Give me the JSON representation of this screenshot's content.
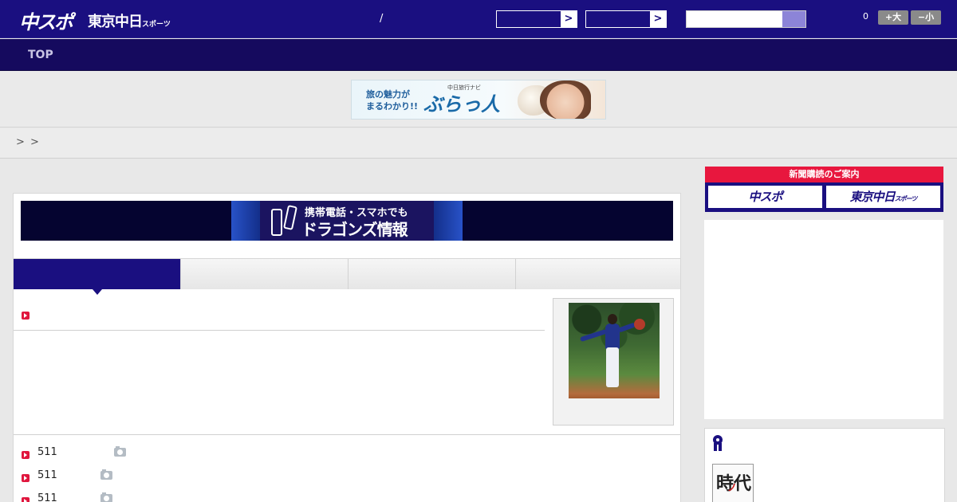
{
  "header": {
    "logo_main": "中スポ",
    "logo_tokyo": "東京中日",
    "logo_tokyo_suffix": "スポーツ",
    "slash": "/",
    "select_arrow": ">",
    "notification_count": "0",
    "font_larger": "+大",
    "font_smaller": "−小"
  },
  "nav": {
    "top_label": "TOP"
  },
  "ad_banner": {
    "line1": "旅の魅力が",
    "line2": "まるわかり!!",
    "brand_small": "中日旅行ナビ",
    "brand_big": "ぶらっ人"
  },
  "breadcrumb": {
    "separators": [
      ">",
      ">"
    ]
  },
  "mobile_banner": {
    "line1": "携帯電話・スマホでも",
    "line2": "ドラゴンズ情報"
  },
  "list": {
    "items": [
      {
        "number": "511"
      },
      {
        "number": "511"
      },
      {
        "number": "511"
      }
    ]
  },
  "sidebar": {
    "subscribe_header": "新聞購読のご案内",
    "subscribe_btn1": "中スポ",
    "subscribe_btn2": "東京中日",
    "subscribe_btn2_suffix": "スポーツ",
    "book_title_char1": "時",
    "book_title_char2": "代",
    "book_red": "ノ"
  },
  "colors": {
    "header_bg": "#1a0f80",
    "nav_bg": "#150a5e",
    "accent_red": "#e8173e",
    "page_bg": "#e8e8e8"
  }
}
